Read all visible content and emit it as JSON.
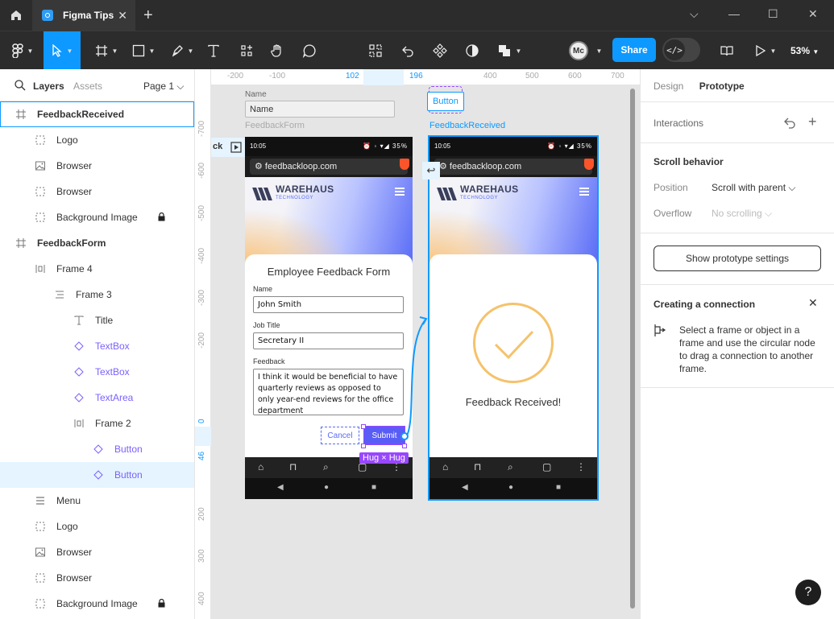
{
  "tab": {
    "title": "Figma Tips"
  },
  "toolbar": {
    "share_label": "Share",
    "zoom": "53%",
    "devmode_label": "</>",
    "avatar_initials": "Mc",
    "accent": "#0d99ff"
  },
  "left_panel": {
    "layers_tab": "Layers",
    "assets_tab": "Assets",
    "page": "Page 1 ⌵",
    "layers": [
      {
        "label": "FeedbackReceived",
        "icon": "frame-icon",
        "depth": 0
      },
      {
        "label": "Logo",
        "icon": "group-icon",
        "depth": 1
      },
      {
        "label": "Browser",
        "icon": "image-icon",
        "depth": 1
      },
      {
        "label": "Browser",
        "icon": "group-icon",
        "depth": 1
      },
      {
        "label": "Background Image",
        "icon": "group-icon",
        "depth": 1
      },
      {
        "label": "FeedbackForm",
        "icon": "frame-icon",
        "depth": 0
      },
      {
        "label": "Frame 4",
        "icon": "autolayout-horizontal-icon",
        "depth": 1
      },
      {
        "label": "Frame 3",
        "icon": "autolayout-vertical-icon",
        "depth": 2
      },
      {
        "label": "Title",
        "icon": "text-icon",
        "depth": 3
      },
      {
        "label": "TextBox",
        "icon": "instance-icon",
        "depth": 3
      },
      {
        "label": "TextBox",
        "icon": "instance-icon",
        "depth": 3
      },
      {
        "label": "TextArea",
        "icon": "instance-icon",
        "depth": 3
      },
      {
        "label": "Frame 2",
        "icon": "autolayout-horizontal-icon",
        "depth": 3
      },
      {
        "label": "Button",
        "icon": "instance-icon",
        "depth": 4
      },
      {
        "label": "Button",
        "icon": "instance-icon",
        "depth": 4
      },
      {
        "label": "Menu",
        "icon": "menu-icon",
        "depth": 1
      },
      {
        "label": "Logo",
        "icon": "group-icon",
        "depth": 1
      },
      {
        "label": "Browser",
        "icon": "image-icon",
        "depth": 1
      },
      {
        "label": "Browser",
        "icon": "group-icon",
        "depth": 1
      },
      {
        "label": "Background Image",
        "icon": "group-icon",
        "depth": 1
      }
    ]
  },
  "canvas": {
    "ruler_top": [
      "-200",
      "-100",
      "102",
      "196",
      "400",
      "500",
      "600",
      "700"
    ],
    "ruler_left": [
      "-700",
      "-600",
      "-500",
      "-400",
      "-300",
      "-200",
      "0",
      "46",
      "200",
      "300",
      "400"
    ],
    "name_component_label": "Name",
    "name_component_value": "Name",
    "button_component_label": "Button",
    "frame_form_name": "FeedbackForm",
    "frame_received_name": "FeedbackReceived",
    "partial_frame_label": "ck",
    "hug_badge": "Hug × Hug",
    "phone": {
      "time": "10:05",
      "battery": "35%",
      "url": "feedbackloop.com",
      "brand": "WAREHAUS",
      "brand_sub": "TECHNOLOGY"
    },
    "form": {
      "title": "Employee Feedback Form",
      "name_label": "Name",
      "name_value": "John Smith",
      "job_label": "Job Title",
      "job_value": "Secretary II",
      "feedback_label": "Feedback",
      "feedback_value": "I think it would be beneficial to have quarterly reviews as opposed to only year-end reviews for the office department",
      "cancel_label": "Cancel",
      "submit_label": "Submit"
    },
    "received": {
      "message": "Feedback Received!"
    }
  },
  "right_panel": {
    "design_tab": "Design",
    "prototype_tab": "Prototype",
    "interactions_title": "Interactions",
    "scroll_title": "Scroll behavior",
    "position_label": "Position",
    "position_value": "Scroll with parent ⌵",
    "overflow_label": "Overflow",
    "overflow_value": "No scrolling ⌵",
    "proto_settings_button": "Show prototype settings",
    "connection_title": "Creating a connection",
    "connection_text": "Select a frame or object in a frame and use the circular node to drag a connection to another frame.",
    "help": "?"
  }
}
